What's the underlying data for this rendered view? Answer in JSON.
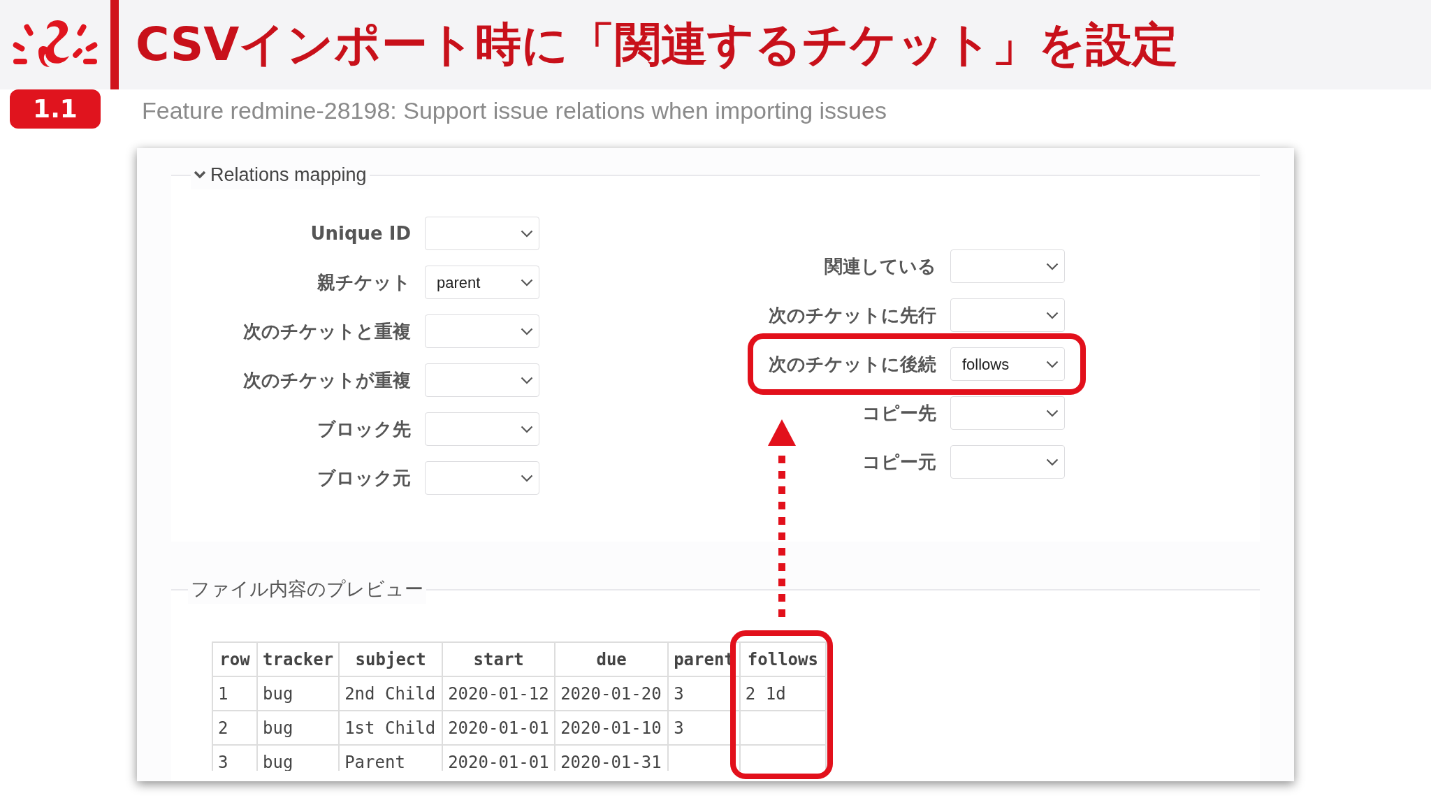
{
  "slide": {
    "title": "CSVインポート時に「関連するチケット」を設定",
    "badge": "1.1",
    "subtitle": "Feature redmine-28198: Support issue relations when importing issues"
  },
  "relations_mapping": {
    "legend": "Relations mapping",
    "expanded": true,
    "left_fields": [
      {
        "label": "Unique ID",
        "highlighted": false
      },
      {
        "label": "親チケット",
        "value": "parent",
        "highlighted": false
      },
      {
        "label": "次のチケットと重複",
        "highlighted": false
      },
      {
        "label": "次のチケットが重複",
        "highlighted": false
      },
      {
        "label": "ブロック先",
        "highlighted": false
      },
      {
        "label": "ブロック元",
        "highlighted": false
      }
    ],
    "right_fields": [
      {
        "label": "関連している",
        "highlighted": false
      },
      {
        "label": "次のチケットに先行",
        "highlighted": false
      },
      {
        "label": "次のチケットに後続",
        "value": "follows",
        "highlighted": true
      },
      {
        "label": "コピー先",
        "highlighted": false
      },
      {
        "label": "コピー元",
        "highlighted": false
      }
    ]
  },
  "preview": {
    "legend": "ファイル内容のプレビュー",
    "columns": [
      {
        "label": "row",
        "highlighted": false
      },
      {
        "label": "tracker",
        "highlighted": false
      },
      {
        "label": "subject",
        "highlighted": false
      },
      {
        "label": "start",
        "highlighted": false
      },
      {
        "label": "due",
        "highlighted": false
      },
      {
        "label": "parent",
        "highlighted": false
      },
      {
        "label": "follows",
        "highlighted": true
      }
    ],
    "rows": [
      [
        "1",
        "bug",
        "2nd Child",
        "2020-01-12",
        "2020-01-20",
        "3",
        "2 1d"
      ],
      [
        "2",
        "bug",
        "1st Child",
        "2020-01-01",
        "2020-01-10",
        "3",
        ""
      ],
      [
        "3",
        "bug",
        "Parent",
        "2020-01-01",
        "2020-01-31",
        "",
        ""
      ]
    ]
  }
}
